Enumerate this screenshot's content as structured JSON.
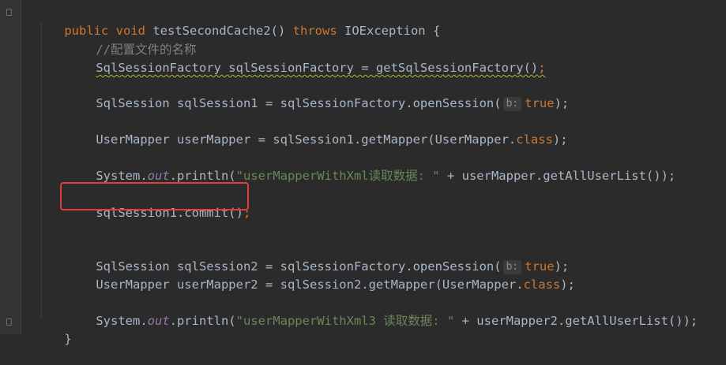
{
  "code": {
    "line_method": {
      "kw_public": "public",
      "kw_void": "void",
      "name": "testSecondCache2",
      "parens": "() ",
      "kw_throws": "throws",
      "exception": " IOException {"
    },
    "line_comment": "//配置文件的名称",
    "line_factory": "SqlSessionFactory sqlSessionFactory = getSqlSessionFactory()",
    "line_factory_end": ";",
    "line_session1": {
      "pre": "SqlSession sqlSession1 = sqlSessionFactory.openSession(",
      "hint": "b:",
      "value": "true",
      "post": ");"
    },
    "line_mapper1": {
      "pre": "UserMapper userMapper = sqlSession1.getMapper(UserMapper.",
      "kw_class": "class",
      "post": ");"
    },
    "line_print1": {
      "pre": "System.",
      "field": "out",
      "mid": ".println(",
      "str": "\"userMapperWithXml读取数据: \"",
      "post": " + userMapper.getAllUserList());"
    },
    "line_commit": "sqlSession1.commit()",
    "line_commit_end": ";",
    "line_session2": {
      "pre": "SqlSession sqlSession2 = sqlSessionFactory.openSession(",
      "hint": "b:",
      "value": "true",
      "post": ");"
    },
    "line_mapper2": {
      "pre": "UserMapper userMapper2 = sqlSession2.getMapper(UserMapper.",
      "kw_class": "class",
      "post": ");"
    },
    "line_print2": {
      "pre": "System.",
      "field": "out",
      "mid": ".println(",
      "str": "\"userMapperWithXml3 读取数据: \"",
      "post": " + userMapper2.getAllUserList());"
    },
    "line_close": "}"
  },
  "colors": {
    "background": "#2b2b2b",
    "keyword": "#cc7832",
    "string": "#6a8759",
    "comment": "#808080",
    "static_field": "#9876aa",
    "highlight_box": "#e03c3c"
  }
}
